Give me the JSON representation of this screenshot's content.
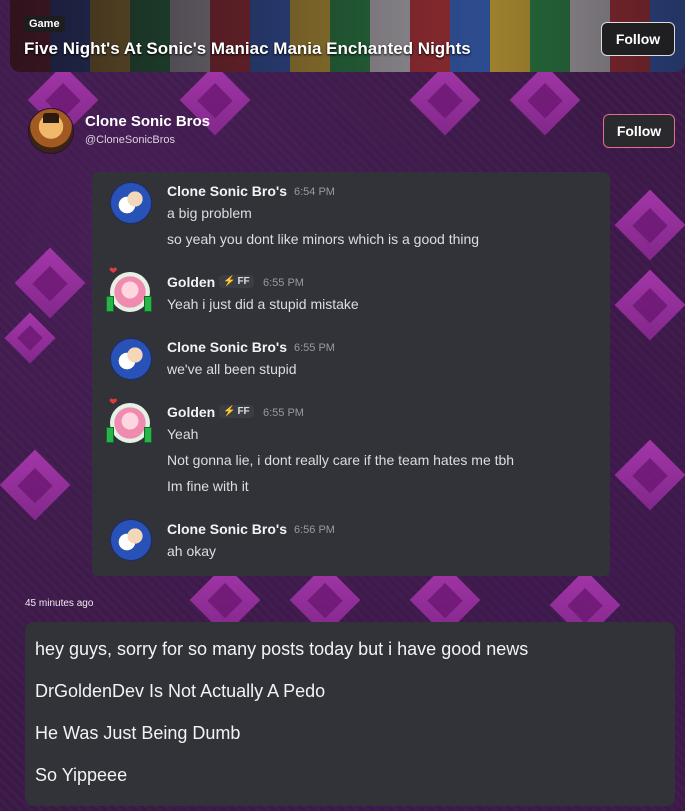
{
  "banner": {
    "tag": "Game",
    "title": "Five Night's At Sonic's Maniac Mania Enchanted Nights",
    "follow_label": "Follow"
  },
  "author": {
    "name": "Clone Sonic Bros",
    "handle": "@CloneSonicBros",
    "follow_label": "Follow"
  },
  "chat": {
    "messages": [
      {
        "user": "Clone Sonic Bro's",
        "time": "6:54 PM",
        "lines": [
          "a big problem",
          "so yeah you dont like minors which is a good thing"
        ]
      },
      {
        "user": "Golden",
        "tag": "FF",
        "time": "6:55 PM",
        "lines": [
          "Yeah i just did a stupid mistake"
        ]
      },
      {
        "user": "Clone Sonic Bro's",
        "time": "6:55 PM",
        "lines": [
          "we've all been stupid"
        ]
      },
      {
        "user": "Golden",
        "tag": "FF",
        "time": "6:55 PM",
        "lines": [
          "Yeah",
          "Not gonna lie, i dont really care if the team hates me tbh",
          "Im fine with it"
        ]
      },
      {
        "user": "Clone Sonic Bro's",
        "time": "6:56 PM",
        "lines": [
          "ah okay"
        ]
      }
    ]
  },
  "post": {
    "timestamp": "45 minutes ago",
    "lines": [
      "hey guys, sorry for so many posts today but i have good news",
      "DrGoldenDev Is Not Actually A Pedo",
      "He Was Just Being Dumb",
      "So Yippeee"
    ]
  },
  "colors": {
    "background": "#3b1947",
    "accent_diamond": "#b43bb8",
    "chat_bg": "#313338",
    "follow_border": "#e06e8e"
  }
}
